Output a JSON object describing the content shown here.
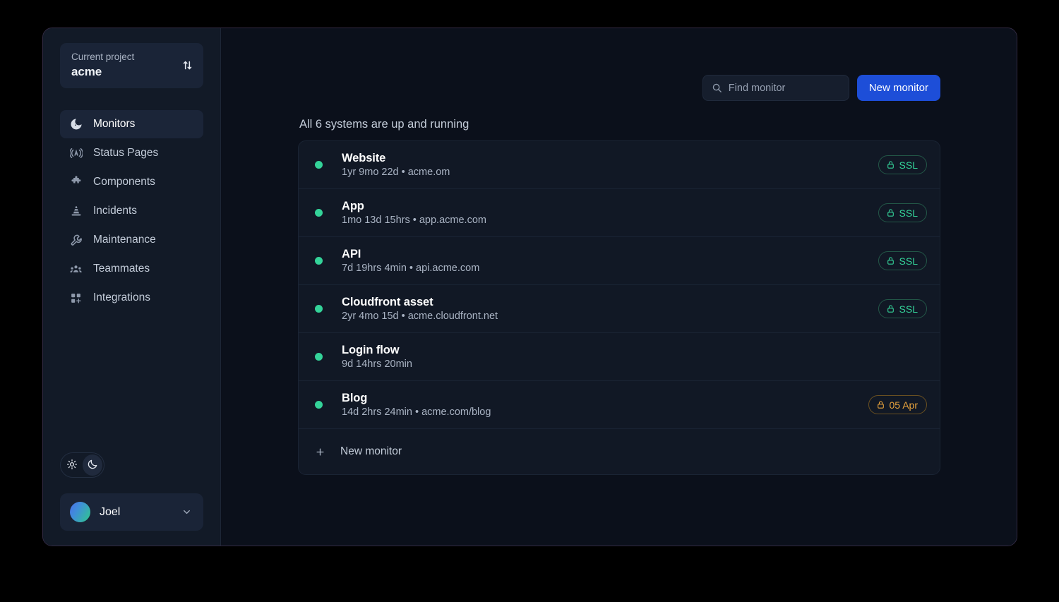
{
  "sidebar": {
    "project": {
      "label": "Current project",
      "value": "acme",
      "switch_icon": "swap-vertical-icon"
    },
    "items": [
      {
        "label": "Monitors",
        "icon": "radar-icon",
        "active": true
      },
      {
        "label": "Status Pages",
        "icon": "broadcast-icon",
        "active": false
      },
      {
        "label": "Components",
        "icon": "puzzle-icon",
        "active": false
      },
      {
        "label": "Incidents",
        "icon": "cone-icon",
        "active": false
      },
      {
        "label": "Maintenance",
        "icon": "wrench-icon",
        "active": false
      },
      {
        "label": "Teammates",
        "icon": "people-icon",
        "active": false
      },
      {
        "label": "Integrations",
        "icon": "grid-plus-icon",
        "active": false
      }
    ],
    "theme": {
      "light_icon": "sun-icon",
      "dark_icon": "moon-icon",
      "selected": "dark"
    },
    "user": {
      "name": "Joel",
      "chevron_icon": "chevron-down-icon"
    }
  },
  "header": {
    "search": {
      "placeholder": "Find monitor",
      "value": "",
      "icon": "search-icon"
    },
    "new_monitor_label": "New monitor"
  },
  "main": {
    "status_heading": "All 6 systems are up and running",
    "monitors": [
      {
        "name": "Website",
        "uptime": "1yr 9mo 22d",
        "host": "acme.om",
        "sub": "1yr 9mo 22d • acme.om",
        "status": "up",
        "badge": {
          "text": "SSL",
          "type": "ssl",
          "icon": "lock-icon"
        }
      },
      {
        "name": "App",
        "uptime": "1mo 13d 15hrs",
        "host": "app.acme.com",
        "sub": "1mo 13d 15hrs • app.acme.com",
        "status": "up",
        "badge": {
          "text": "SSL",
          "type": "ssl",
          "icon": "lock-icon"
        }
      },
      {
        "name": "API",
        "uptime": "7d 19hrs 4min",
        "host": "api.acme.com",
        "sub": "7d 19hrs 4min • api.acme.com",
        "status": "up",
        "badge": {
          "text": "SSL",
          "type": "ssl",
          "icon": "lock-icon"
        }
      },
      {
        "name": "Cloudfront asset",
        "uptime": "2yr 4mo 15d",
        "host": "acme.cloudfront.net",
        "sub": "2yr 4mo 15d • acme.cloudfront.net",
        "status": "up",
        "badge": {
          "text": "SSL",
          "type": "ssl",
          "icon": "lock-icon"
        }
      },
      {
        "name": "Login flow",
        "uptime": "9d 14hrs 20min",
        "host": "",
        "sub": "9d 14hrs 20min",
        "status": "up",
        "badge": null
      },
      {
        "name": "Blog",
        "uptime": "14d 2hrs 24min",
        "host": "acme.com/blog",
        "sub": "14d 2hrs 24min • acme.com/blog",
        "status": "up",
        "badge": {
          "text": "05 Apr",
          "type": "expiry",
          "icon": "lock-icon"
        }
      }
    ],
    "new_monitor_row": {
      "label": "New monitor",
      "icon": "plus-icon"
    }
  },
  "colors": {
    "accent_blue": "#1d4ed8",
    "status_up_green": "#34d399",
    "ssl_green": "#34d399",
    "expiry_amber": "#e8a33d",
    "sidebar_bg": "#121a27",
    "main_bg": "#0b101b",
    "card_bg": "#111825"
  }
}
